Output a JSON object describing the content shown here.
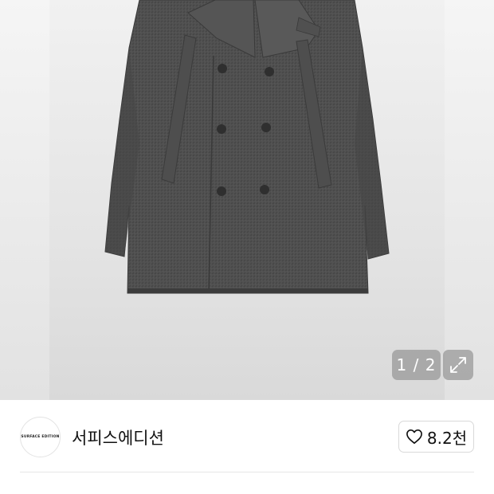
{
  "gallery": {
    "counter": "1 / 2",
    "expand_icon": "expand-icon",
    "image_subject": "double-breasted charcoal wool pea coat"
  },
  "brand": {
    "logo_text": "SURFACE EDITION",
    "name": "서피스에디션"
  },
  "like": {
    "icon": "heart-outline-icon",
    "count": "8.2천"
  }
}
